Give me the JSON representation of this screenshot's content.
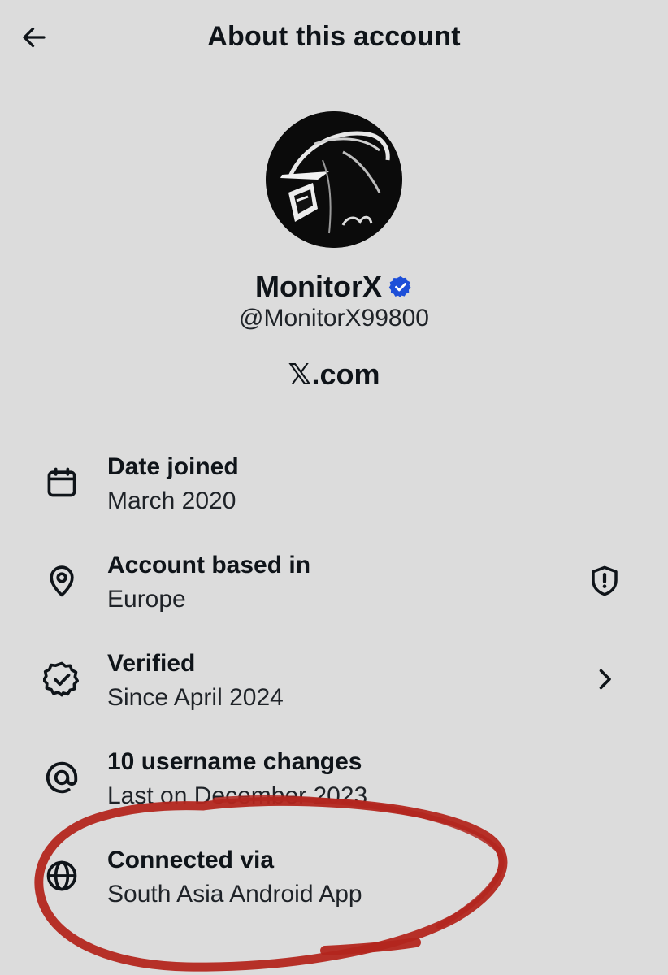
{
  "header": {
    "title": "About this account",
    "back_icon": "arrow-left-icon"
  },
  "profile": {
    "name": "MonitorX",
    "handle": "@MonitorX99800",
    "verified_badge_color": "#1d4fd8",
    "site": "𝕏.com"
  },
  "info_rows": [
    {
      "icon": "calendar-icon",
      "title": "Date joined",
      "value": "March 2020"
    },
    {
      "icon": "location-pin-icon",
      "title": "Account based in",
      "value": "Europe",
      "trailing_icon": "shield-alert-icon"
    },
    {
      "icon": "verified-outline-icon",
      "title": "Verified",
      "value": "Since April 2024",
      "trailing_icon": "chevron-right-icon"
    },
    {
      "icon": "at-sign-icon",
      "title": "10 username changes",
      "value": "Last on December 2023"
    },
    {
      "icon": "globe-icon",
      "title": "Connected via",
      "value": "South Asia Android App"
    }
  ],
  "annotation": {
    "color": "#b3261e",
    "shape": "hand-drawn-circle"
  },
  "colors": {
    "background": "#dcdcdc",
    "text": "#0f1419"
  }
}
